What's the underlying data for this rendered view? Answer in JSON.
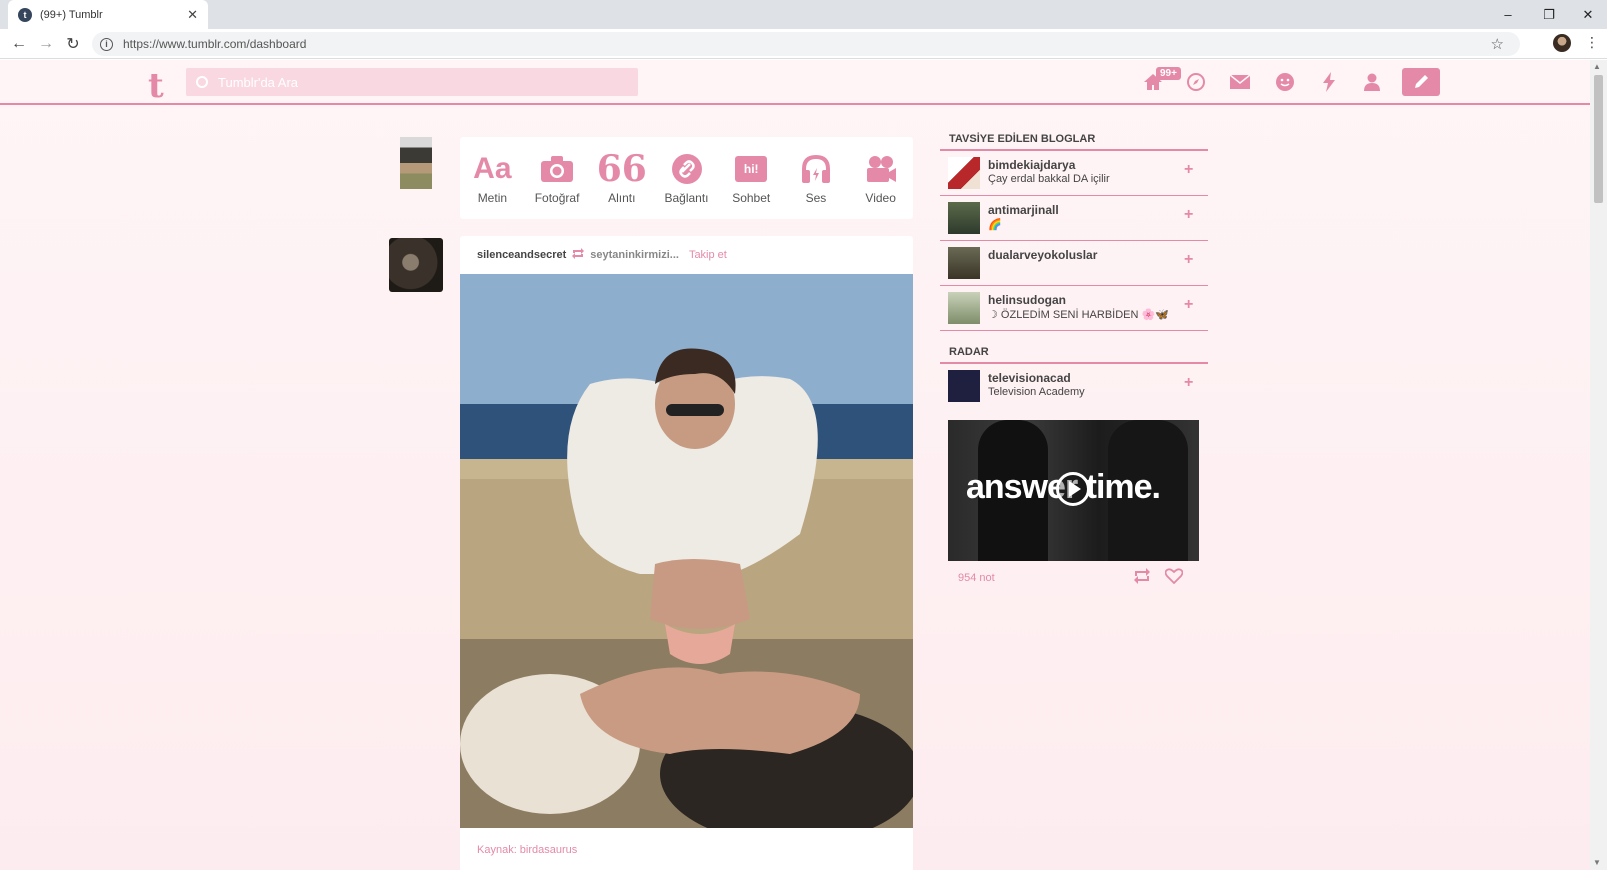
{
  "browser": {
    "tab_title": "(99+) Tumblr",
    "tab_close": "✕",
    "url": "https://www.tumblr.com/dashboard",
    "minimize": "–",
    "restore": "❐",
    "close": "✕"
  },
  "header": {
    "logo": "t",
    "search_placeholder": "Tumblr'da Ara",
    "notification_badge": "99+",
    "accent_color": "#e48aa8"
  },
  "composer": {
    "post_types": [
      {
        "label": "Metin",
        "icon": "text-icon"
      },
      {
        "label": "Fotoğraf",
        "icon": "camera-icon"
      },
      {
        "label": "Alıntı",
        "icon": "quote-icon"
      },
      {
        "label": "Bağlantı",
        "icon": "link-icon"
      },
      {
        "label": "Sohbet",
        "icon": "chat-icon"
      },
      {
        "label": "Ses",
        "icon": "headphones-icon"
      },
      {
        "label": "Video",
        "icon": "video-camera-icon"
      }
    ],
    "text_glyph": "Aa",
    "quote_glyph": "66",
    "chat_glyph": "hi!"
  },
  "post": {
    "blog_name": "silenceandsecret",
    "reblogged_from": "seytaninkirmizi...",
    "follow_label": "Takip et",
    "source_label": "Kaynak: birdasaurus"
  },
  "sidebar": {
    "recommended_title": "TAVSİYE EDİLEN BLOGLAR",
    "recommended": [
      {
        "name": "bimdekiajdarya",
        "desc": "Çay erdal bakkal DA içilir"
      },
      {
        "name": "antimarjinall",
        "desc": "🌈"
      },
      {
        "name": "dualarveyokoluslar",
        "desc": ""
      },
      {
        "name": "helinsudogan",
        "desc": "☽ ÖZLEDİM SENİ HARBİDEN 🌸🦋"
      }
    ],
    "radar_title": "RADAR",
    "radar": {
      "name": "televisionacad",
      "desc": "Television Academy",
      "video_text": "answer time.",
      "notes": "954 not"
    },
    "plus": "+"
  }
}
